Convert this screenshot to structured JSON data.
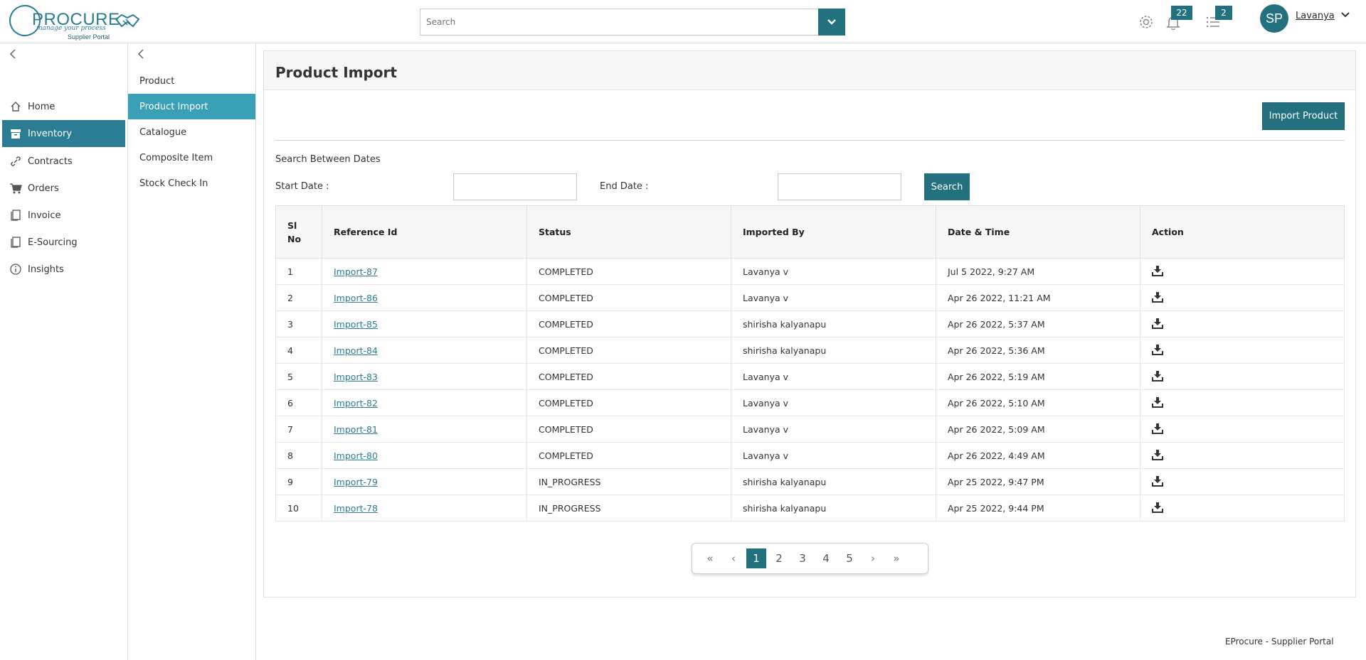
{
  "header": {
    "logo": {
      "word": "PROCURE",
      "tagline": "manage your process",
      "subtitle": "Supplier Portal"
    },
    "search": {
      "placeholder": "Search"
    },
    "notifications_count": "22",
    "tasks_count": "2",
    "avatar_initials": "SP",
    "user_name": "Lavanya"
  },
  "sidebar": {
    "items": [
      {
        "label": "Home",
        "icon": "home-icon"
      },
      {
        "label": "Inventory",
        "icon": "archive-icon"
      },
      {
        "label": "Contracts",
        "icon": "link-icon"
      },
      {
        "label": "Orders",
        "icon": "cart-icon"
      },
      {
        "label": "Invoice",
        "icon": "document-icon"
      },
      {
        "label": "E-Sourcing",
        "icon": "document-icon"
      },
      {
        "label": "Insights",
        "icon": "info-icon"
      }
    ]
  },
  "subnav": {
    "items": [
      {
        "label": "Product"
      },
      {
        "label": "Product Import"
      },
      {
        "label": "Catalogue"
      },
      {
        "label": "Composite Item"
      },
      {
        "label": "Stock Check In"
      }
    ]
  },
  "main": {
    "title": "Product Import",
    "import_button": "Import Product",
    "search_between": "Search Between Dates",
    "start_label": "Start Date :",
    "end_label": "End Date :",
    "search_button": "Search",
    "columns": [
      "Sl No",
      "Reference Id",
      "Status",
      "Imported By",
      "Date & Time",
      "Action"
    ],
    "rows": [
      {
        "sl": "1",
        "ref": "Import-87",
        "status": "COMPLETED",
        "by": "Lavanya v",
        "date": "Jul 5 2022, 9:27 AM"
      },
      {
        "sl": "2",
        "ref": "Import-86",
        "status": "COMPLETED",
        "by": "Lavanya v",
        "date": "Apr 26 2022, 11:21 AM"
      },
      {
        "sl": "3",
        "ref": "Import-85",
        "status": "COMPLETED",
        "by": "shirisha kalyanapu",
        "date": "Apr 26 2022, 5:37 AM"
      },
      {
        "sl": "4",
        "ref": "Import-84",
        "status": "COMPLETED",
        "by": "shirisha kalyanapu",
        "date": "Apr 26 2022, 5:36 AM"
      },
      {
        "sl": "5",
        "ref": "Import-83",
        "status": "COMPLETED",
        "by": "Lavanya v",
        "date": "Apr 26 2022, 5:19 AM"
      },
      {
        "sl": "6",
        "ref": "Import-82",
        "status": "COMPLETED",
        "by": "Lavanya v",
        "date": "Apr 26 2022, 5:10 AM"
      },
      {
        "sl": "7",
        "ref": "Import-81",
        "status": "COMPLETED",
        "by": "Lavanya v",
        "date": "Apr 26 2022, 5:09 AM"
      },
      {
        "sl": "8",
        "ref": "Import-80",
        "status": "COMPLETED",
        "by": "Lavanya v",
        "date": "Apr 26 2022, 4:49 AM"
      },
      {
        "sl": "9",
        "ref": "Import-79",
        "status": "IN_PROGRESS",
        "by": "shirisha kalyanapu",
        "date": "Apr 25 2022, 9:47 PM"
      },
      {
        "sl": "10",
        "ref": "Import-78",
        "status": "IN_PROGRESS",
        "by": "shirisha kalyanapu",
        "date": "Apr 25 2022, 9:44 PM"
      }
    ],
    "pagination": {
      "first": "«",
      "prev": "‹",
      "pages": [
        "1",
        "2",
        "3",
        "4",
        "5"
      ],
      "current": "1",
      "next": "›",
      "last": "»"
    }
  },
  "footer": "EProcure - Supplier Portal",
  "colors": {
    "brand": "#23707f",
    "active_nav": "#2a7d93",
    "active_subnav": "#3aa0b6"
  }
}
